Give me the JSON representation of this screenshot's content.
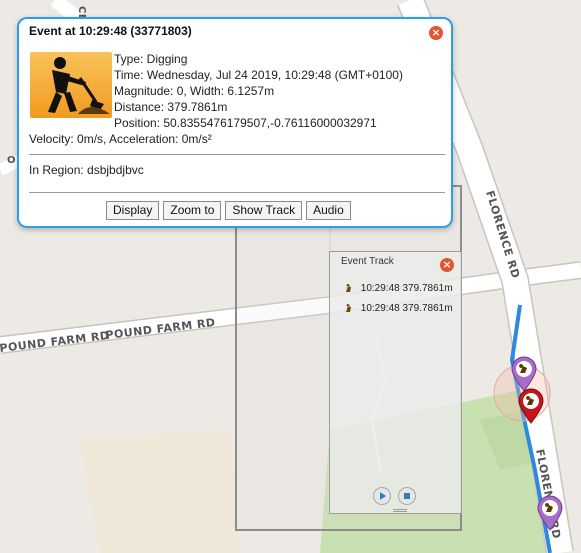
{
  "map": {
    "streets": {
      "pound_farm_rd_left": "POUND FARM RD",
      "pound_farm_rd_right": "POUND FARM RD",
      "florence_rd_top": "FLORENCE RD",
      "florence_rd_bottom": "FLORENCE RD",
      "partial_left_label": "O",
      "partial_top_label": "CE"
    },
    "colors": {
      "track_line": "#2b8ae0",
      "park": "#c9e0b0",
      "road": "#ffffff"
    }
  },
  "popup": {
    "title": "Event at 10:29:48 (33771803)",
    "icon": "digging-worker-icon",
    "type": "Type: Digging",
    "time": "Time: Wednesday, Jul 24 2019, 10:29:48 (GMT+0100)",
    "magnitude": "Magnitude: 0, Width: 6.1257m",
    "distance": "Distance: 379.7861m",
    "position": "Position: 50.8355476179507,-0.76116000032971",
    "velocity": "Velocity: 0m/s, Acceleration: 0m/s²",
    "region": "In Region: dsbjbdjbvc",
    "buttons": {
      "display": "Display",
      "zoom": "Zoom to",
      "show_track": "Show Track",
      "audio": "Audio"
    }
  },
  "event_track": {
    "title": "Event Track",
    "rows": [
      {
        "time": "10:29:48",
        "distance": "379.7861m"
      },
      {
        "time": "10:29:48",
        "distance": "379.7861m"
      }
    ]
  }
}
